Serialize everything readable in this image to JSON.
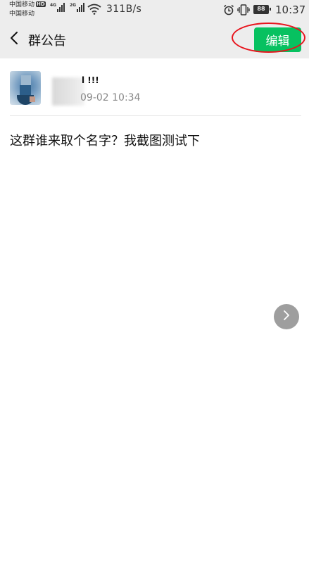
{
  "status_bar": {
    "carrier_1": "中国移动",
    "hd_badge": "HD",
    "carrier_2": "中国移动",
    "signal_1_tag": "4G",
    "signal_2_tag": "2G",
    "net_speed": "311B/s",
    "battery": "88",
    "time": "10:37"
  },
  "nav": {
    "title": "群公告",
    "edit_label": "编辑"
  },
  "post": {
    "author": "l !!!",
    "time": "09-02 10:34",
    "content": "这群谁来取个名字？我截图测试下"
  },
  "colors": {
    "accent": "#07c160",
    "annotation": "#e8141d",
    "bar_bg": "#ededed"
  },
  "icons": [
    "back-arrow-icon",
    "alarm-icon",
    "vibrate-icon",
    "wifi-icon",
    "chevron-right-icon"
  ]
}
